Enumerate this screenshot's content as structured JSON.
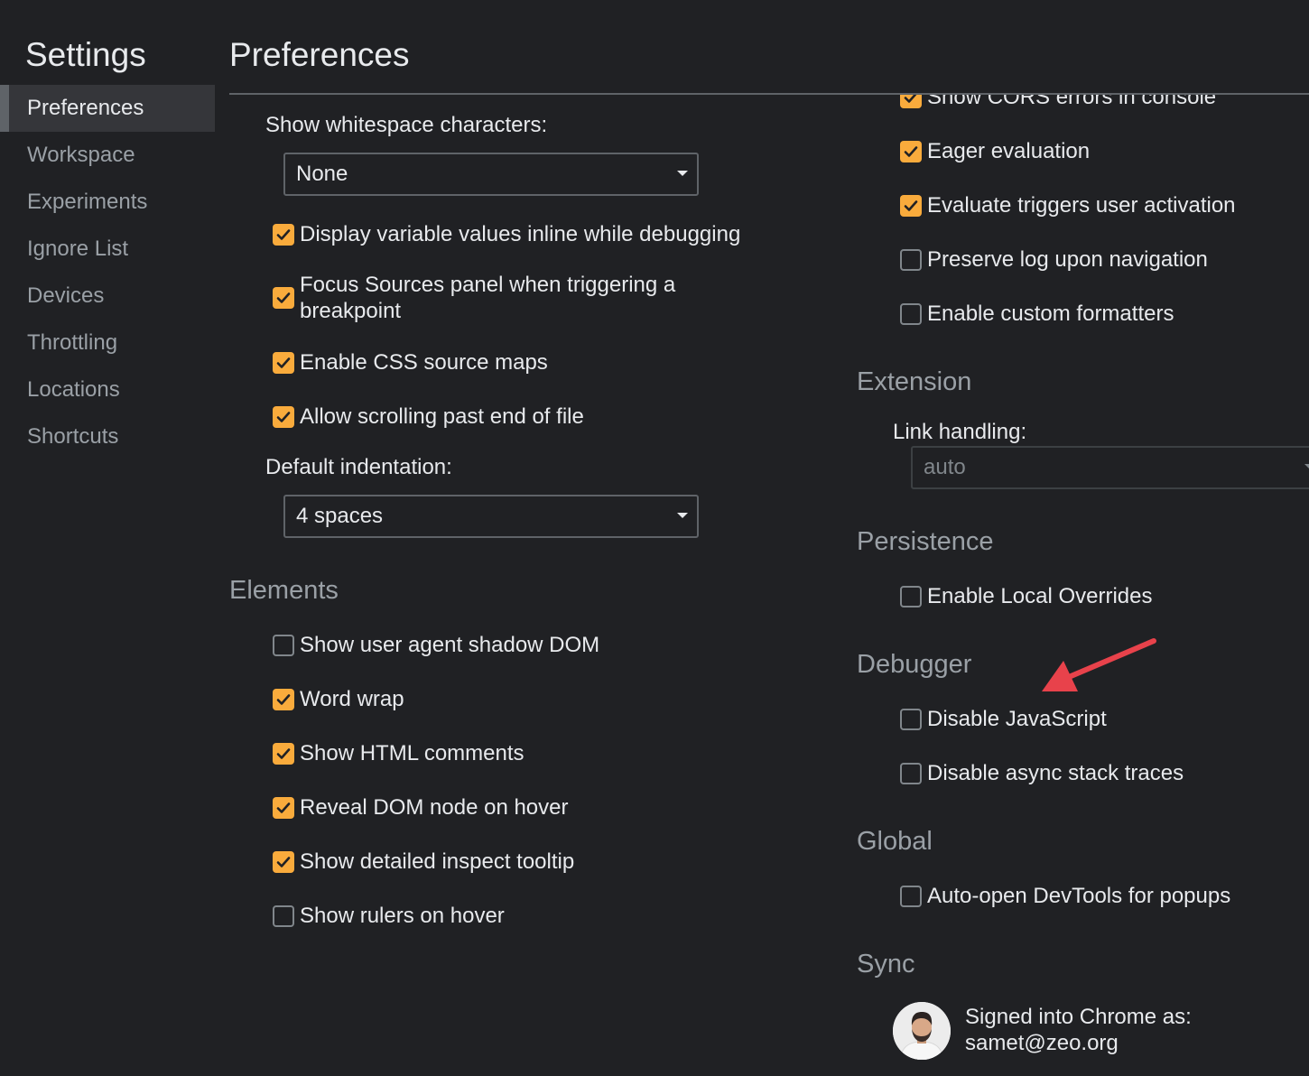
{
  "sidebar": {
    "title": "Settings",
    "items": [
      {
        "label": "Preferences",
        "selected": true
      },
      {
        "label": "Workspace"
      },
      {
        "label": "Experiments"
      },
      {
        "label": "Ignore List"
      },
      {
        "label": "Devices"
      },
      {
        "label": "Throttling"
      },
      {
        "label": "Locations"
      },
      {
        "label": "Shortcuts"
      }
    ]
  },
  "main": {
    "title": "Preferences",
    "left": {
      "whitespace_label": "Show whitespace characters:",
      "whitespace_value": "None",
      "sources_checks": [
        {
          "label": "Display variable values inline while debugging",
          "checked": true
        },
        {
          "label": "Focus Sources panel when triggering a breakpoint",
          "checked": true
        },
        {
          "label": "Enable CSS source maps",
          "checked": true
        },
        {
          "label": "Allow scrolling past end of file",
          "checked": true
        }
      ],
      "indent_label": "Default indentation:",
      "indent_value": "4 spaces",
      "elements_heading": "Elements",
      "elements_checks": [
        {
          "label": "Show user agent shadow DOM",
          "checked": false
        },
        {
          "label": "Word wrap",
          "checked": true
        },
        {
          "label": "Show HTML comments",
          "checked": true
        },
        {
          "label": "Reveal DOM node on hover",
          "checked": true
        },
        {
          "label": "Show detailed inspect tooltip",
          "checked": true
        },
        {
          "label": "Show rulers on hover",
          "checked": false
        }
      ]
    },
    "right": {
      "console_checks": [
        {
          "label": "Show CORS errors in console",
          "checked": true
        },
        {
          "label": "Eager evaluation",
          "checked": true
        },
        {
          "label": "Evaluate triggers user activation",
          "checked": true
        },
        {
          "label": "Preserve log upon navigation",
          "checked": false
        },
        {
          "label": "Enable custom formatters",
          "checked": false
        }
      ],
      "extension_heading": "Extension",
      "link_handling_label": "Link handling:",
      "link_handling_value": "auto",
      "persistence_heading": "Persistence",
      "persistence_checks": [
        {
          "label": "Enable Local Overrides",
          "checked": false
        }
      ],
      "debugger_heading": "Debugger",
      "debugger_checks": [
        {
          "label": "Disable JavaScript",
          "checked": false
        },
        {
          "label": "Disable async stack traces",
          "checked": false
        }
      ],
      "global_heading": "Global",
      "global_checks": [
        {
          "label": "Auto-open DevTools for popups",
          "checked": false
        }
      ],
      "sync_heading": "Sync",
      "sync_line1": "Signed into Chrome as:",
      "sync_email": "samet@zeo.org"
    }
  },
  "colors": {
    "background": "#202124",
    "checkbox_checked": "#f9ab3c",
    "annotation_arrow": "#e8424b"
  },
  "icons": {
    "checkbox_checked": "checkmark-icon",
    "dropdown": "chevron-down-icon",
    "annotation": "red-arrow-icon"
  }
}
